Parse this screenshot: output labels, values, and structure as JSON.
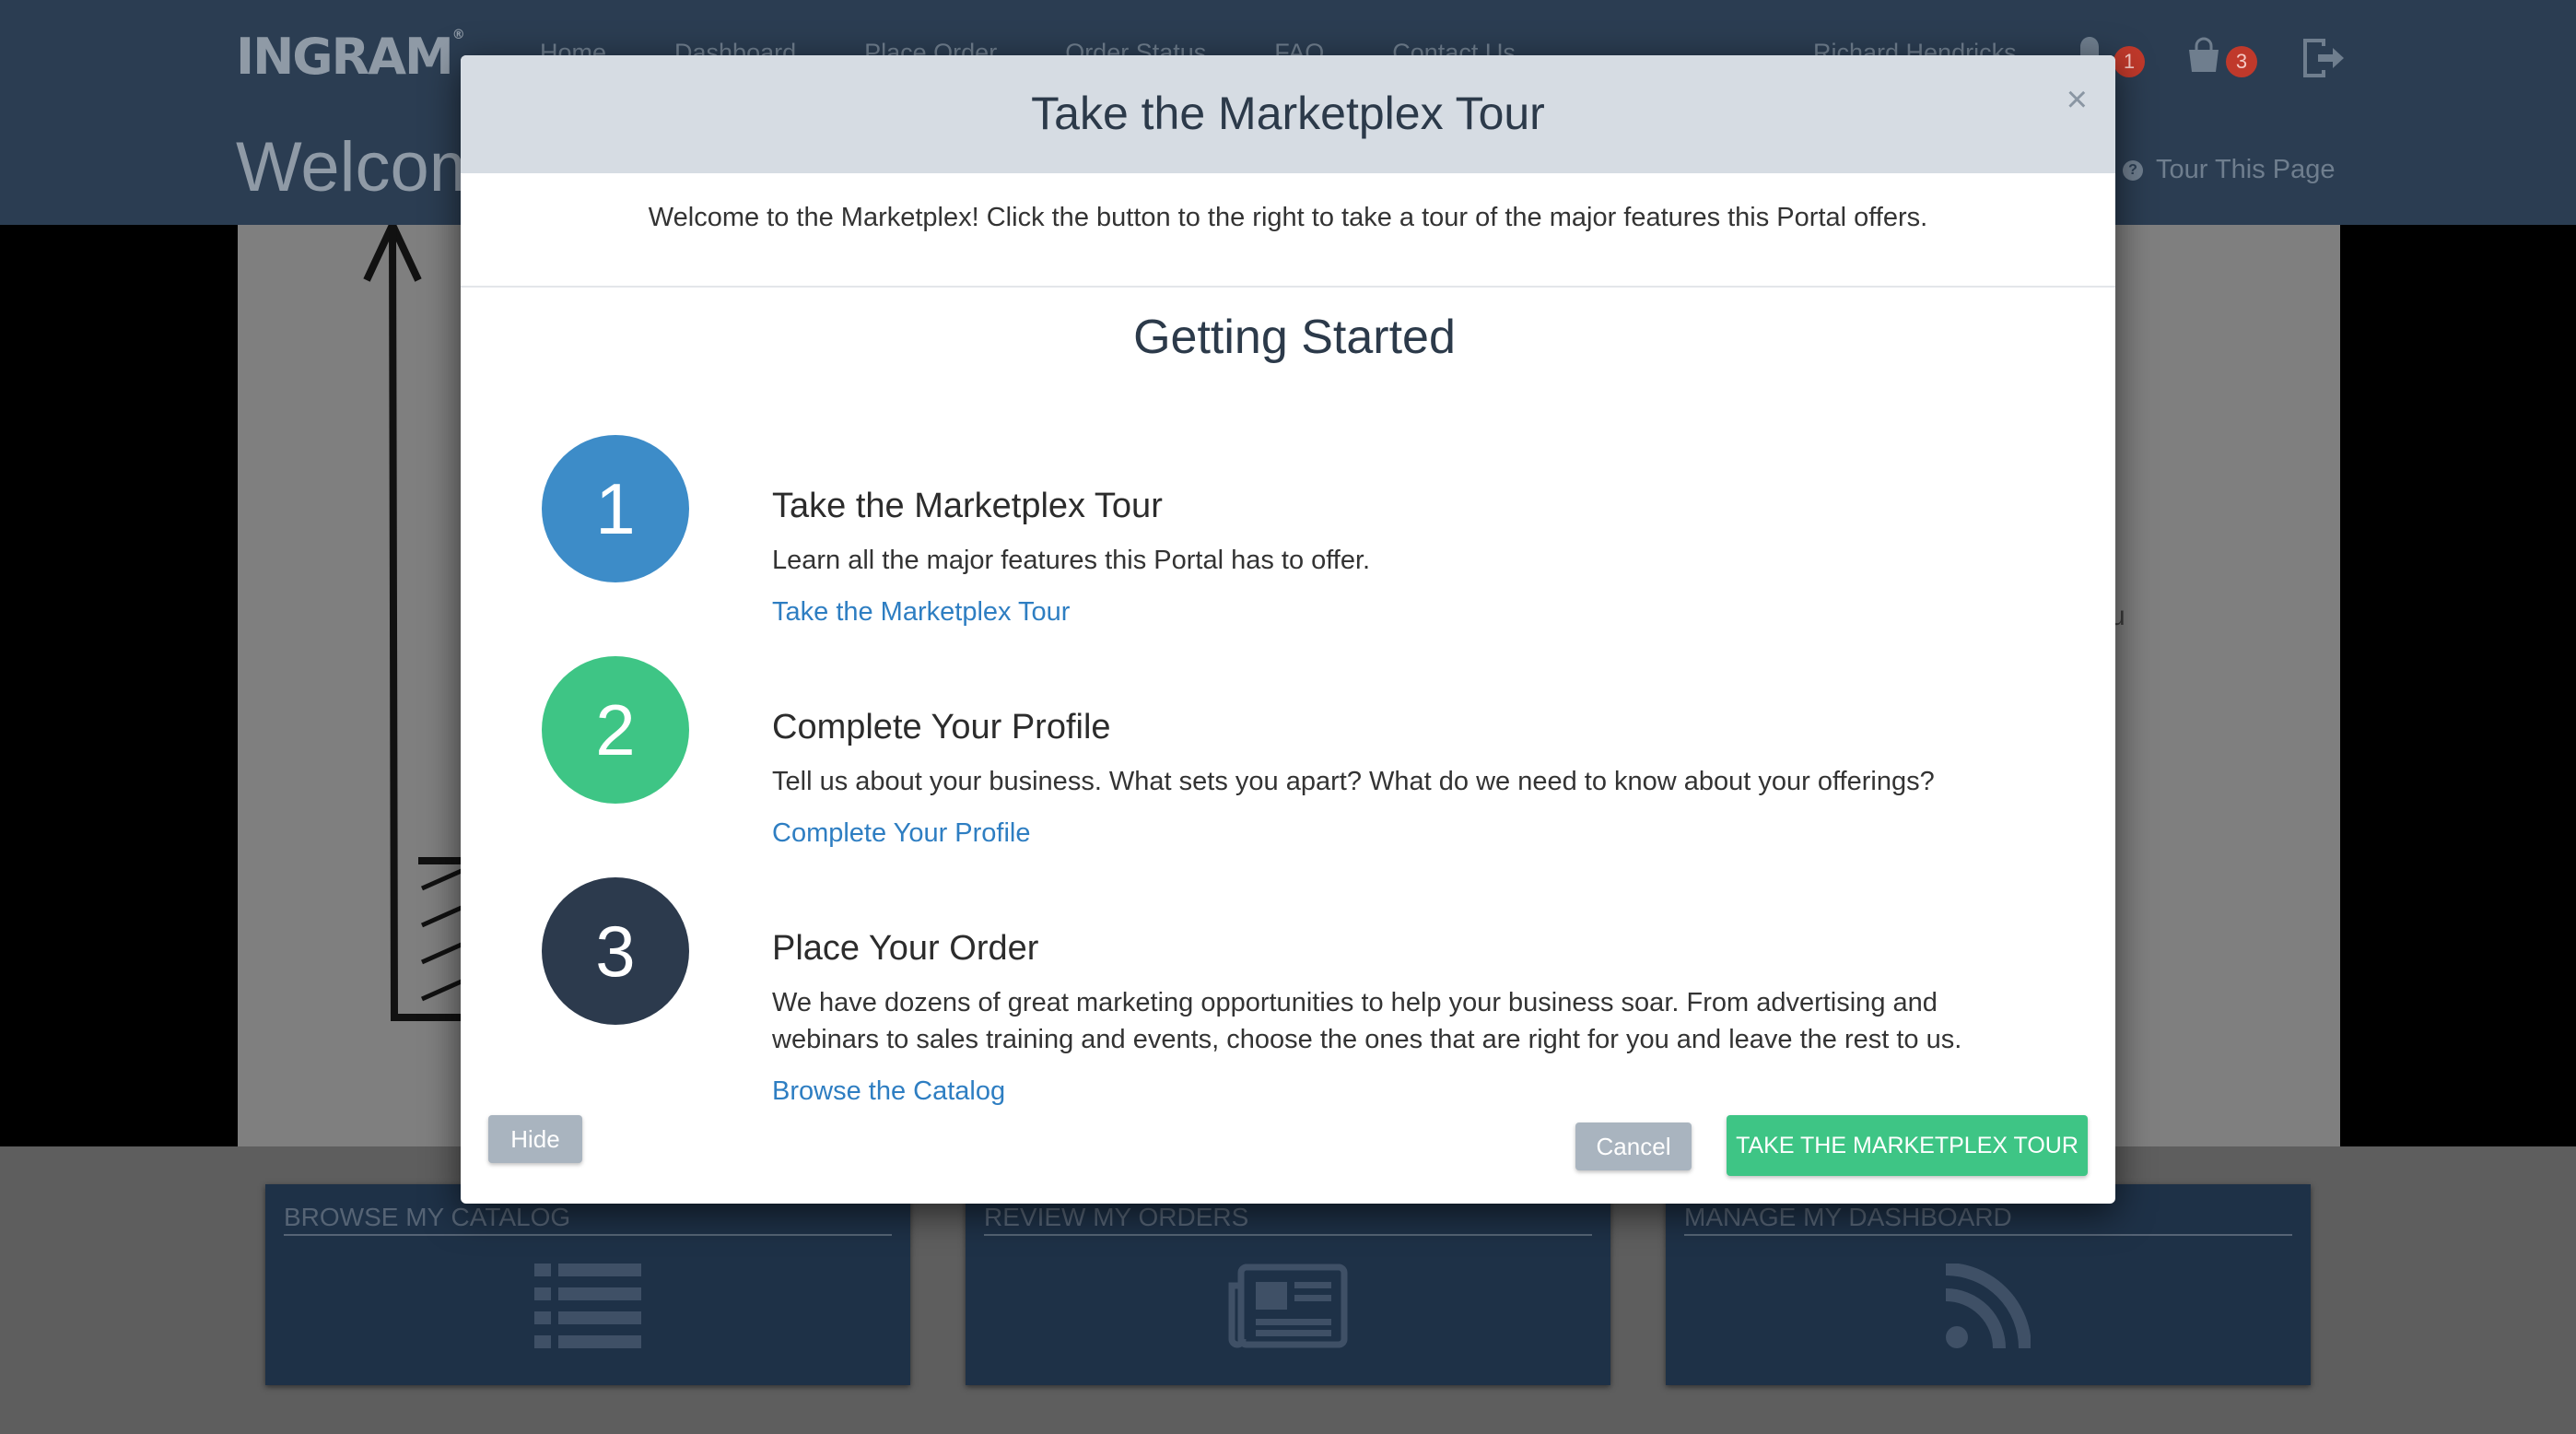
{
  "header": {
    "logo": "INGRAM",
    "nav": [
      "Home",
      "Dashboard",
      "Place Order",
      "Order Status",
      "FAQ",
      "Contact Us"
    ],
    "user_name": "Richard Hendricks",
    "notification_count": "1",
    "cart_count": "3",
    "page_title": "Welcome",
    "tour_link": "Tour This Page"
  },
  "hero": {
    "side_text": "u\n."
  },
  "tiles": [
    {
      "title": "BROWSE MY CATALOG",
      "icon": "list-icon"
    },
    {
      "title": "REVIEW MY ORDERS",
      "icon": "newspaper-icon"
    },
    {
      "title": "MANAGE MY DASHBOARD",
      "icon": "rss-icon"
    }
  ],
  "modal": {
    "title": "Take the Marketplex Tour",
    "intro": "Welcome to the Marketplex! Click the button to the right to take a tour of the major features this Portal offers.",
    "section_title": "Getting Started",
    "steps": [
      {
        "number": "1",
        "title": "Take the Marketplex Tour",
        "description": "Learn all the major features this Portal has to offer.",
        "link": "Take the Marketplex Tour",
        "color": "#3d8cc8"
      },
      {
        "number": "2",
        "title": "Complete Your Profile",
        "description": "Tell us about your business. What sets you apart? What do we need to know about your offerings?",
        "link": "Complete Your Profile",
        "color": "#3ec585"
      },
      {
        "number": "3",
        "title": "Place Your Order",
        "description": "We have dozens of great marketing opportunities to help your business soar. From advertising and webinars to sales training and events, choose the ones that are right for you and leave the rest to us.",
        "link": "Browse the Catalog",
        "color": "#2c3a4d"
      }
    ],
    "hide_label": "Hide",
    "cancel_label": "Cancel",
    "tour_button_label": "TAKE THE MARKETPLEX TOUR",
    "close_label": "×"
  }
}
